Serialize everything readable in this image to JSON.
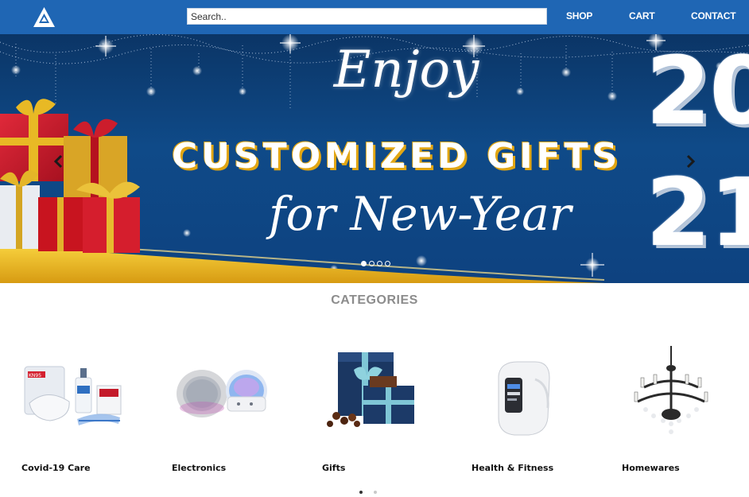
{
  "navbar": {
    "logo_icon": "triangle-logo-icon",
    "search_placeholder": "Search..",
    "links": [
      "SHOP",
      "CART",
      "CONTACT"
    ],
    "bg_color": "#1f66b4"
  },
  "banner": {
    "line1": "Enjoy",
    "line2": "CUSTOMIZED GIFTS",
    "line3": "for New-Year",
    "year_top": "20",
    "year_bottom": "21",
    "slide_count": 4,
    "active_slide": 1,
    "prev_icon": "chevron-left-icon",
    "next_icon": "chevron-right-icon"
  },
  "categories": {
    "title": "CATEGORIES",
    "items": [
      {
        "label": "Covid-19 Care",
        "icon": "covid-care-image"
      },
      {
        "label": "Electronics",
        "icon": "speakers-image"
      },
      {
        "label": "Gifts",
        "icon": "gift-box-image"
      },
      {
        "label": "Health & Fitness",
        "icon": "fitness-band-image"
      },
      {
        "label": "Homewares",
        "icon": "chandelier-image"
      }
    ],
    "page_count": 2,
    "active_page": 1
  }
}
